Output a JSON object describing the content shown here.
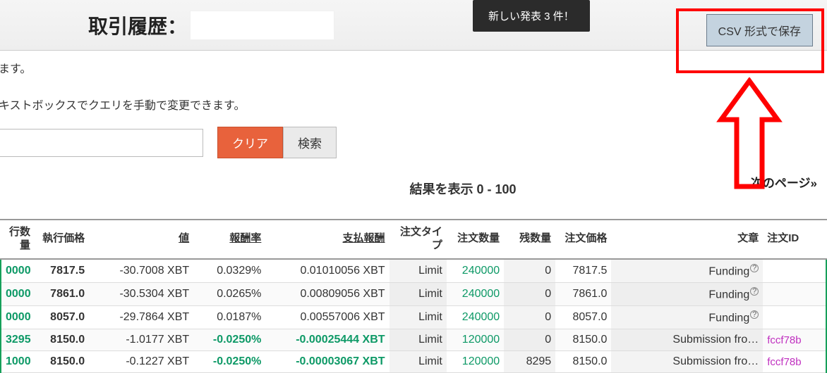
{
  "header": {
    "title": "取引履歴：",
    "notification": "新しい発表 3 件！",
    "csv_button": "CSV 形式で保存"
  },
  "body": {
    "line1": "ます。",
    "line2": "キストボックスでクエリを手動で変更できます。",
    "clear_btn": "クリア",
    "search_btn": "検索",
    "results_label": "結果を表示 0 - 100",
    "next_page": "次のページ»"
  },
  "columns": {
    "c0": "行数量",
    "c1": "執行価格",
    "c2": "値",
    "c3": "報酬率",
    "c4": "支払報酬",
    "c5": "注文タイプ",
    "c6": "注文数量",
    "c7": "残数量",
    "c8": "注文価格",
    "c9": "文章",
    "c10": "注文ID"
  },
  "rows": [
    {
      "qty": "0000",
      "price": "7817.5",
      "value": "-30.7008 XBT",
      "rate": "0.0329%",
      "fee": "0.01010056 XBT",
      "type": "Limit",
      "oqty": "240000",
      "remain": "0",
      "oprice": "7817.5",
      "text": "Funding",
      "oid": ""
    },
    {
      "qty": "0000",
      "price": "7861.0",
      "value": "-30.5304 XBT",
      "rate": "0.0265%",
      "fee": "0.00809056 XBT",
      "type": "Limit",
      "oqty": "240000",
      "remain": "0",
      "oprice": "7861.0",
      "text": "Funding",
      "oid": ""
    },
    {
      "qty": "0000",
      "price": "8057.0",
      "value": "-29.7864 XBT",
      "rate": "0.0187%",
      "fee": "0.00557006 XBT",
      "type": "Limit",
      "oqty": "240000",
      "remain": "0",
      "oprice": "8057.0",
      "text": "Funding",
      "oid": ""
    },
    {
      "qty": "3295",
      "price": "8150.0",
      "value": "-1.0177 XBT",
      "rate": "-0.0250%",
      "fee": "-0.00025444 XBT",
      "type": "Limit",
      "oqty": "120000",
      "remain": "0",
      "oprice": "8150.0",
      "text": "Submission fro…",
      "oid": "fccf78b"
    },
    {
      "qty": "1000",
      "price": "8150.0",
      "value": "-0.1227 XBT",
      "rate": "-0.0250%",
      "fee": "-0.00003067 XBT",
      "type": "Limit",
      "oqty": "120000",
      "remain": "8295",
      "oprice": "8150.0",
      "text": "Submission fro…",
      "oid": "fccf78b"
    }
  ]
}
